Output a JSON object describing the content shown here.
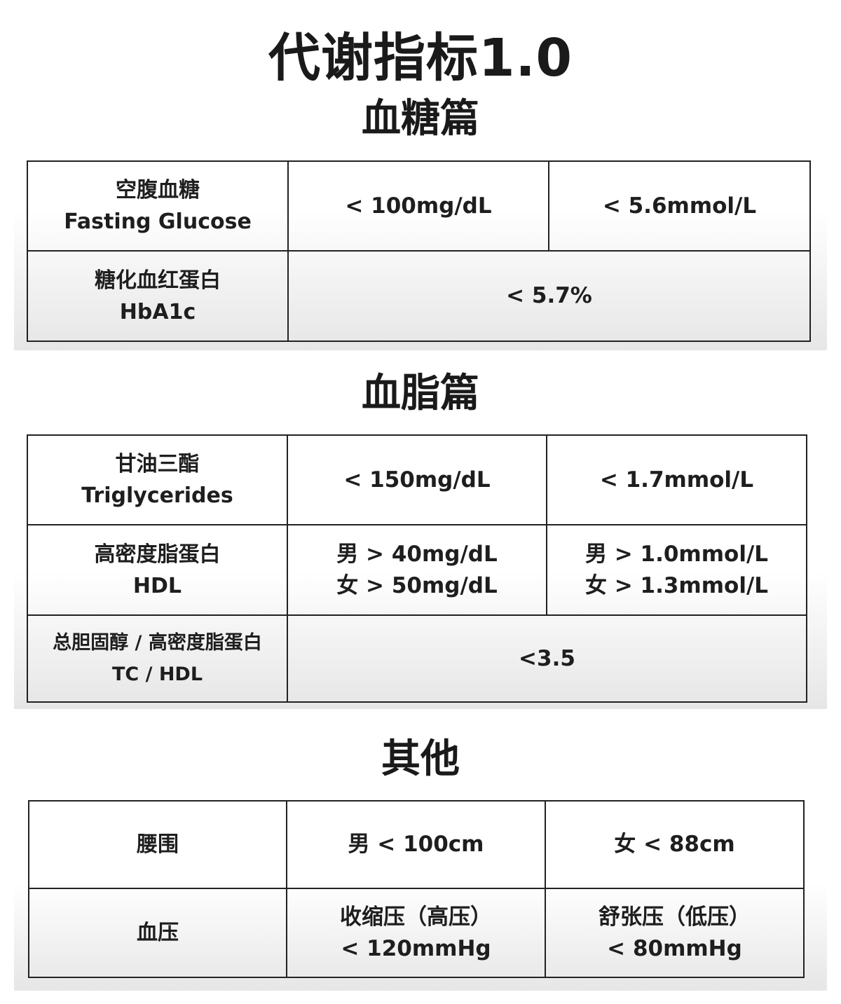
{
  "title": "代谢指标1.0",
  "sections": [
    {
      "heading": "血糖篇",
      "rows": [
        {
          "zh": "空腹血糖",
          "en": "Fasting Glucose",
          "v1": "< 100mg/dL",
          "v2": "< 5.6mmol/L"
        },
        {
          "zh": "糖化血红蛋白",
          "en": "HbA1c",
          "v": "< 5.7%"
        }
      ]
    },
    {
      "heading": "血脂篇",
      "rows": [
        {
          "zh": "甘油三酯",
          "en": "Triglycerides",
          "v1": "< 150mg/dL",
          "v2": "< 1.7mmol/L"
        },
        {
          "zh": "高密度脂蛋白",
          "en": "HDL",
          "v1a": "男 > 40mg/dL",
          "v1b": "女 > 50mg/dL",
          "v2a": "男 > 1.0mmol/L",
          "v2b": "女 > 1.3mmol/L"
        },
        {
          "zh": "总胆固醇 / 高密度脂蛋白",
          "en": "TC / HDL",
          "v": "<3.5"
        }
      ]
    },
    {
      "heading": "其他",
      "rows": [
        {
          "zh": "腰围",
          "v1": "男 < 100cm",
          "v2": "女 < 88cm"
        },
        {
          "zh": "血压",
          "v1a": "收缩压（高压）",
          "v1b": "< 120mmHg",
          "v2a": "舒张压（低压）",
          "v2b": "< 80mmHg"
        }
      ]
    }
  ]
}
